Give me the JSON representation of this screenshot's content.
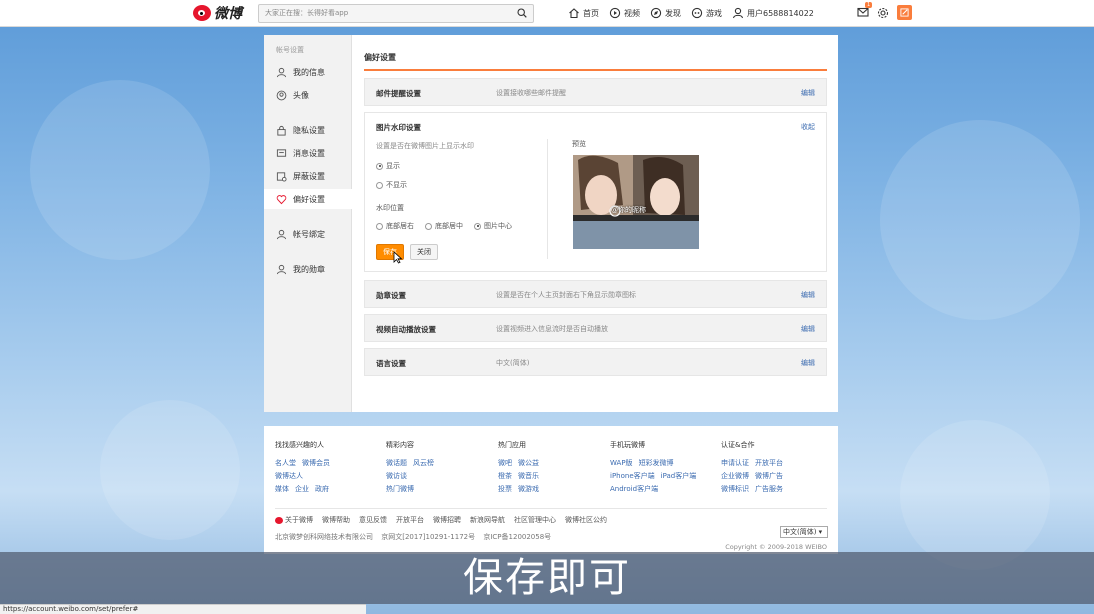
{
  "topnav": {
    "logo_text": "微博",
    "search_placeholder": "大家正在搜：长得好看app",
    "links": [
      {
        "label": "首页",
        "icon": "home-icon"
      },
      {
        "label": "视频",
        "icon": "video-icon"
      },
      {
        "label": "发现",
        "icon": "discover-icon"
      },
      {
        "label": "游戏",
        "icon": "game-icon"
      },
      {
        "label": "用户6588814022",
        "icon": "user-icon"
      }
    ],
    "mail_badge": "1",
    "accent_color": "#fa7d3c"
  },
  "sidebar": {
    "group_title": "帐号设置",
    "items": [
      {
        "label": "我的信息",
        "icon": "user-icon"
      },
      {
        "label": "头像",
        "icon": "avatar-icon"
      },
      {
        "label": "隐私设置",
        "icon": "lock-icon"
      },
      {
        "label": "消息设置",
        "icon": "message-icon"
      },
      {
        "label": "屏蔽设置",
        "icon": "block-icon"
      },
      {
        "label": "偏好设置",
        "icon": "heart-settings-icon",
        "active": true
      },
      {
        "label": "帐号绑定",
        "icon": "bind-icon"
      },
      {
        "label": "我的勋章",
        "icon": "medal-icon"
      }
    ]
  },
  "main": {
    "title": "偏好设置",
    "rows": [
      {
        "name": "邮件提醒设置",
        "desc": "设置接收哪些邮件提醒",
        "action": "编辑"
      },
      {
        "name": "勋章设置",
        "desc": "设置是否在个人主页封面右下角显示勋章图标",
        "action": "编辑"
      },
      {
        "name": "视频自动播放设置",
        "desc": "设置视频进入信息流时是否自动播放",
        "action": "编辑"
      },
      {
        "name": "语言设置",
        "desc": "中文(简体)",
        "action": "编辑"
      }
    ],
    "watermark": {
      "name": "图片水印设置",
      "collapse": "收起",
      "desc": "设置是否在微博图片上显示水印",
      "options": [
        {
          "label": "显示",
          "checked": true
        },
        {
          "label": "不显示",
          "checked": false
        }
      ],
      "position_label": "水印位置",
      "positions": [
        {
          "label": "底部居右",
          "checked": false
        },
        {
          "label": "底部居中",
          "checked": false
        },
        {
          "label": "图片中心",
          "checked": true
        }
      ],
      "save": "保存",
      "close": "关闭",
      "preview_label": "预览",
      "preview_watermark": "@你的昵称"
    }
  },
  "footer": {
    "columns": [
      {
        "title": "找找感兴趣的人",
        "lines": [
          [
            "名人堂",
            "微博会员"
          ],
          [
            "微博达人"
          ],
          [
            "媒体",
            "企业",
            "政府"
          ]
        ]
      },
      {
        "title": "精彩内容",
        "lines": [
          [
            "微话题",
            "风云榜"
          ],
          [
            "微访谈"
          ],
          [
            "热门微博"
          ]
        ]
      },
      {
        "title": "热门应用",
        "lines": [
          [
            "微吧",
            "微公益"
          ],
          [
            "橙茶",
            "微音乐"
          ],
          [
            "投票",
            "微游戏"
          ]
        ]
      },
      {
        "title": "手机玩微博",
        "lines": [
          [
            "WAP版",
            "短彩发微博"
          ],
          [
            "iPhone客户端",
            "iPad客户端"
          ],
          [
            "Android客户端"
          ]
        ]
      },
      {
        "title": "认证&合作",
        "lines": [
          [
            "申请认证",
            "开放平台"
          ],
          [
            "企业微博",
            "微博广告"
          ],
          [
            "微博标识",
            "广告服务"
          ]
        ]
      }
    ],
    "bottom_links": [
      "关于微博",
      "微博帮助",
      "意见反馈",
      "开放平台",
      "微博招聘",
      "新浪网导航",
      "社区管理中心",
      "微博社区公约"
    ],
    "company": "北京微梦创科网络技术有限公司",
    "license1": "京网文[2017]10291-1172号",
    "license2": "京ICP备12002058号",
    "language": "中文(简体) ▾",
    "copyright": "Copyright © 2009-2018 WEIBO"
  },
  "subtitle": "保存即可",
  "status_url": "https://account.weibo.com/set/prefer#"
}
